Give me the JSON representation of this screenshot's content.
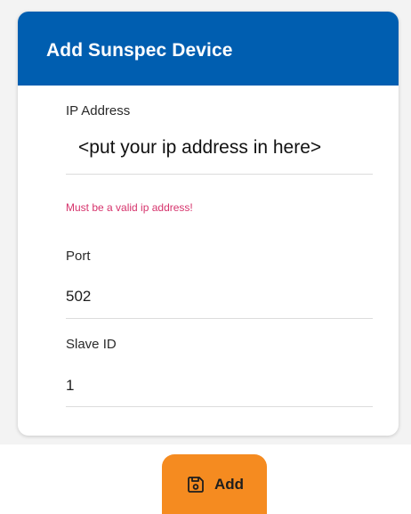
{
  "dialog": {
    "title": "Add Sunspec Device",
    "ip_address": {
      "label": "IP Address",
      "value": "<put your ip address in here>",
      "error": "Must be a valid ip address!"
    },
    "port": {
      "label": "Port",
      "value": "502"
    },
    "slave_id": {
      "label": "Slave ID",
      "value": "1"
    }
  },
  "actions": {
    "add_label": "Add",
    "add_icon": "save-icon",
    "add_color": "#f58b20"
  },
  "colors": {
    "header": "#005eb0",
    "error": "#d6336c"
  }
}
